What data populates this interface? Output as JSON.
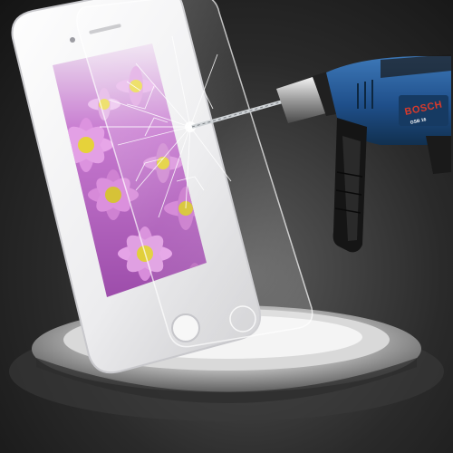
{
  "product": {
    "device": "phone-with-tempered-glass-screen-protector",
    "tool": "power-drill"
  },
  "drill": {
    "brand_label": "BOSCH",
    "model_label": "GSB 16"
  },
  "colors": {
    "background": "#2a2a2a",
    "phone_body": "#f2f2f4",
    "drill_body": "#1f4f8a",
    "drill_brand": "#d93a2b",
    "flower_pink": "#d58ad8",
    "flower_center": "#e6d23a"
  }
}
